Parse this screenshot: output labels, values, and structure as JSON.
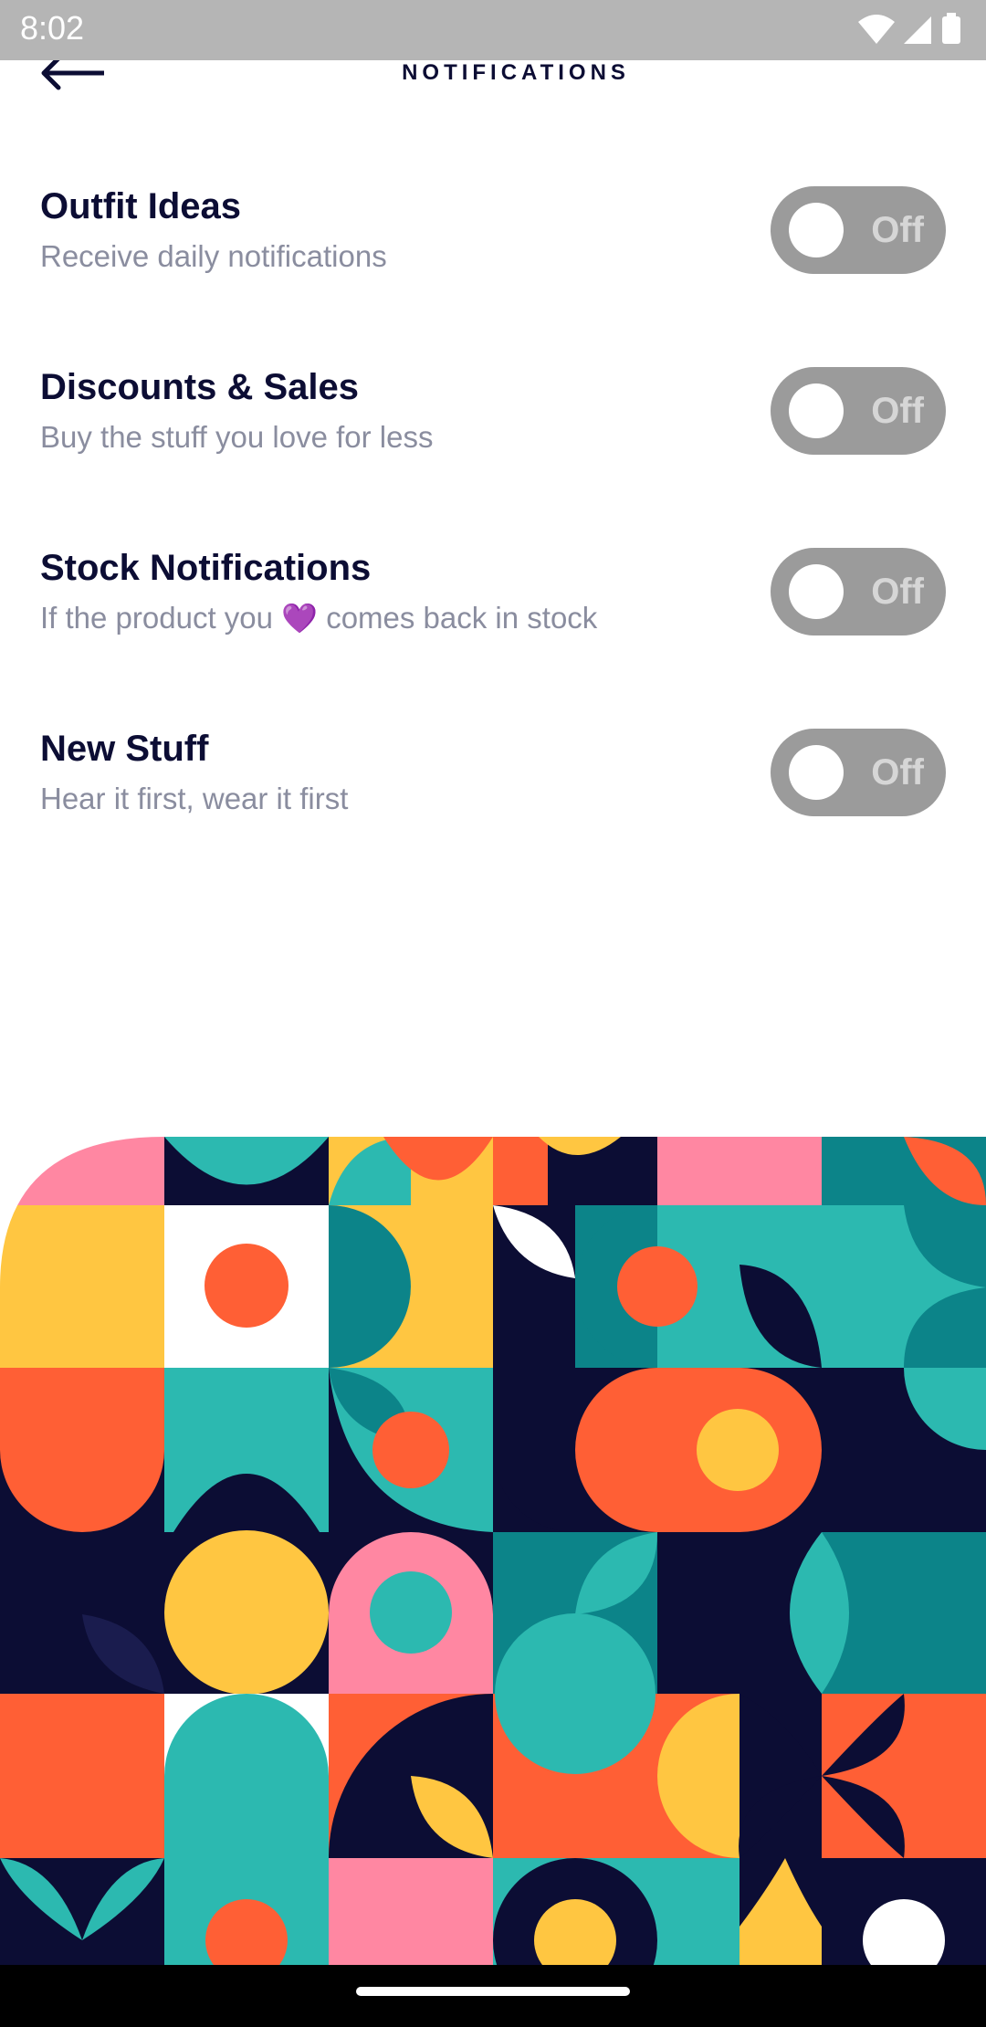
{
  "status_bar": {
    "time": "8:02",
    "icons": [
      "wifi-icon",
      "signal-icon",
      "battery-icon"
    ]
  },
  "header": {
    "title": "NOTIFICATIONS",
    "back_icon": "arrow-left-icon"
  },
  "settings": [
    {
      "title": "Outfit Ideas",
      "subtitle": "Receive daily notifications",
      "toggle": "Off"
    },
    {
      "title": "Discounts & Sales",
      "subtitle": "Buy the stuff you love for less",
      "toggle": "Off"
    },
    {
      "title": "Stock Notifications",
      "subtitle_before": "If the product you",
      "subtitle_emoji": "💜",
      "subtitle_after": "comes back in stock",
      "toggle": "Off"
    },
    {
      "title": "New Stuff",
      "subtitle": "Hear it first, wear it first",
      "toggle": "Off"
    }
  ],
  "colors": {
    "navy": "#0c0d34",
    "teal": "#2cb9b0",
    "dark_teal": "#0c8489",
    "orange": "#ff5f35",
    "yellow": "#ffc641",
    "pink": "#ff87a2",
    "toggle_off": "#9b9b9b",
    "subtitle": "#8a8d9f"
  }
}
